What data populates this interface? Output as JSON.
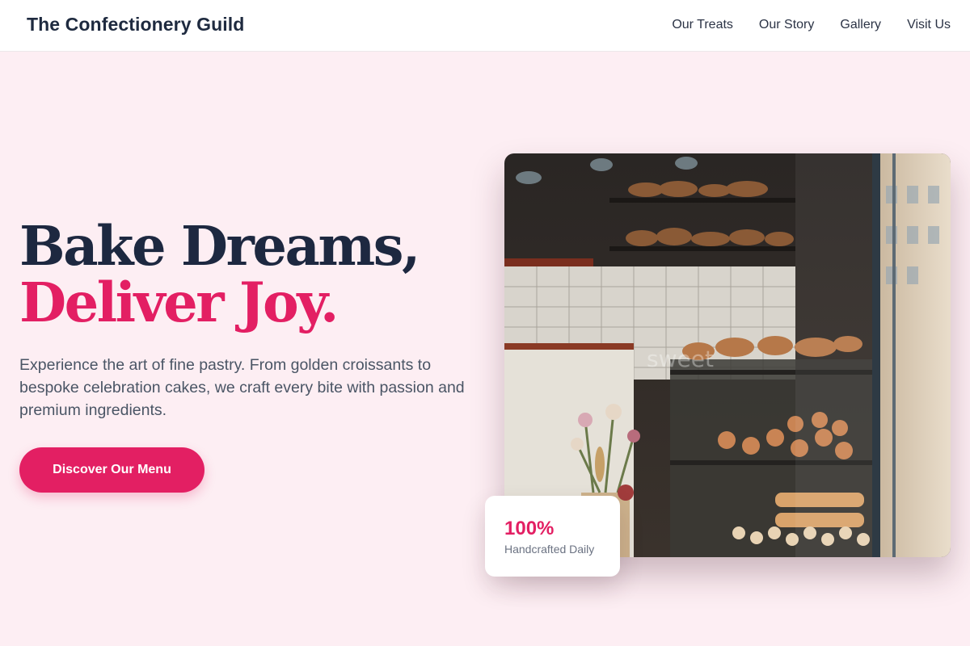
{
  "header": {
    "brand": "The Confectionery Guild",
    "nav": [
      {
        "label": "Our Treats"
      },
      {
        "label": "Our Story"
      },
      {
        "label": "Gallery"
      },
      {
        "label": "Visit Us"
      }
    ]
  },
  "hero": {
    "title_line_1": "Bake Dreams,",
    "title_line_2": "Deliver Joy.",
    "subtitle": "Experience the art of fine pastry. From golden croissants to bespoke celebration cakes, we craft every bite with passion and premium ingredients.",
    "cta_label": "Discover Our Menu"
  },
  "image": {
    "alt": "Bakery display case with breads and pastries",
    "window_text": "sweet"
  },
  "stat": {
    "value": "100%",
    "label": "Handcrafted Daily"
  },
  "colors": {
    "accent": "#e31f63",
    "heading": "#1d2840",
    "background": "#fdeef3"
  }
}
